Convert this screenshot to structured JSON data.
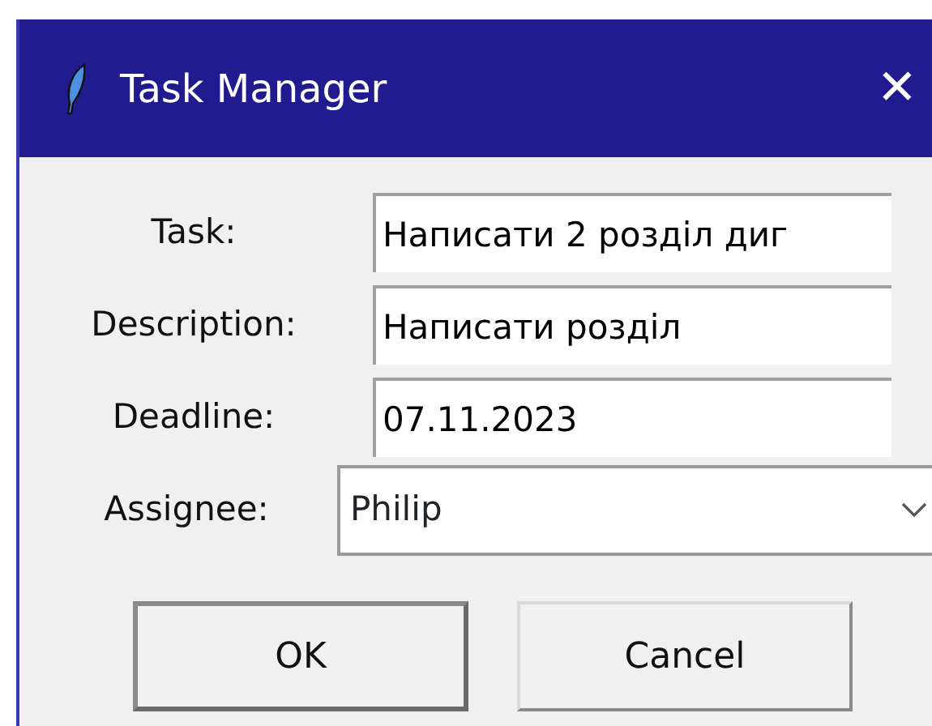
{
  "window": {
    "title": "Task Manager",
    "close": "✕"
  },
  "fields": [
    {
      "kind": "entry",
      "label": "Task:",
      "value": "Написати 2 розділ диг"
    },
    {
      "kind": "entry",
      "label": "Description:",
      "value": "Написати розділ"
    },
    {
      "kind": "entry",
      "label": "Deadline:",
      "value": "07.11.2023"
    },
    {
      "kind": "combobox",
      "label": "Assignee:",
      "value": "Philip"
    }
  ],
  "buttons": [
    {
      "label": "OK",
      "default": true
    },
    {
      "label": "Cancel",
      "default": false
    }
  ]
}
